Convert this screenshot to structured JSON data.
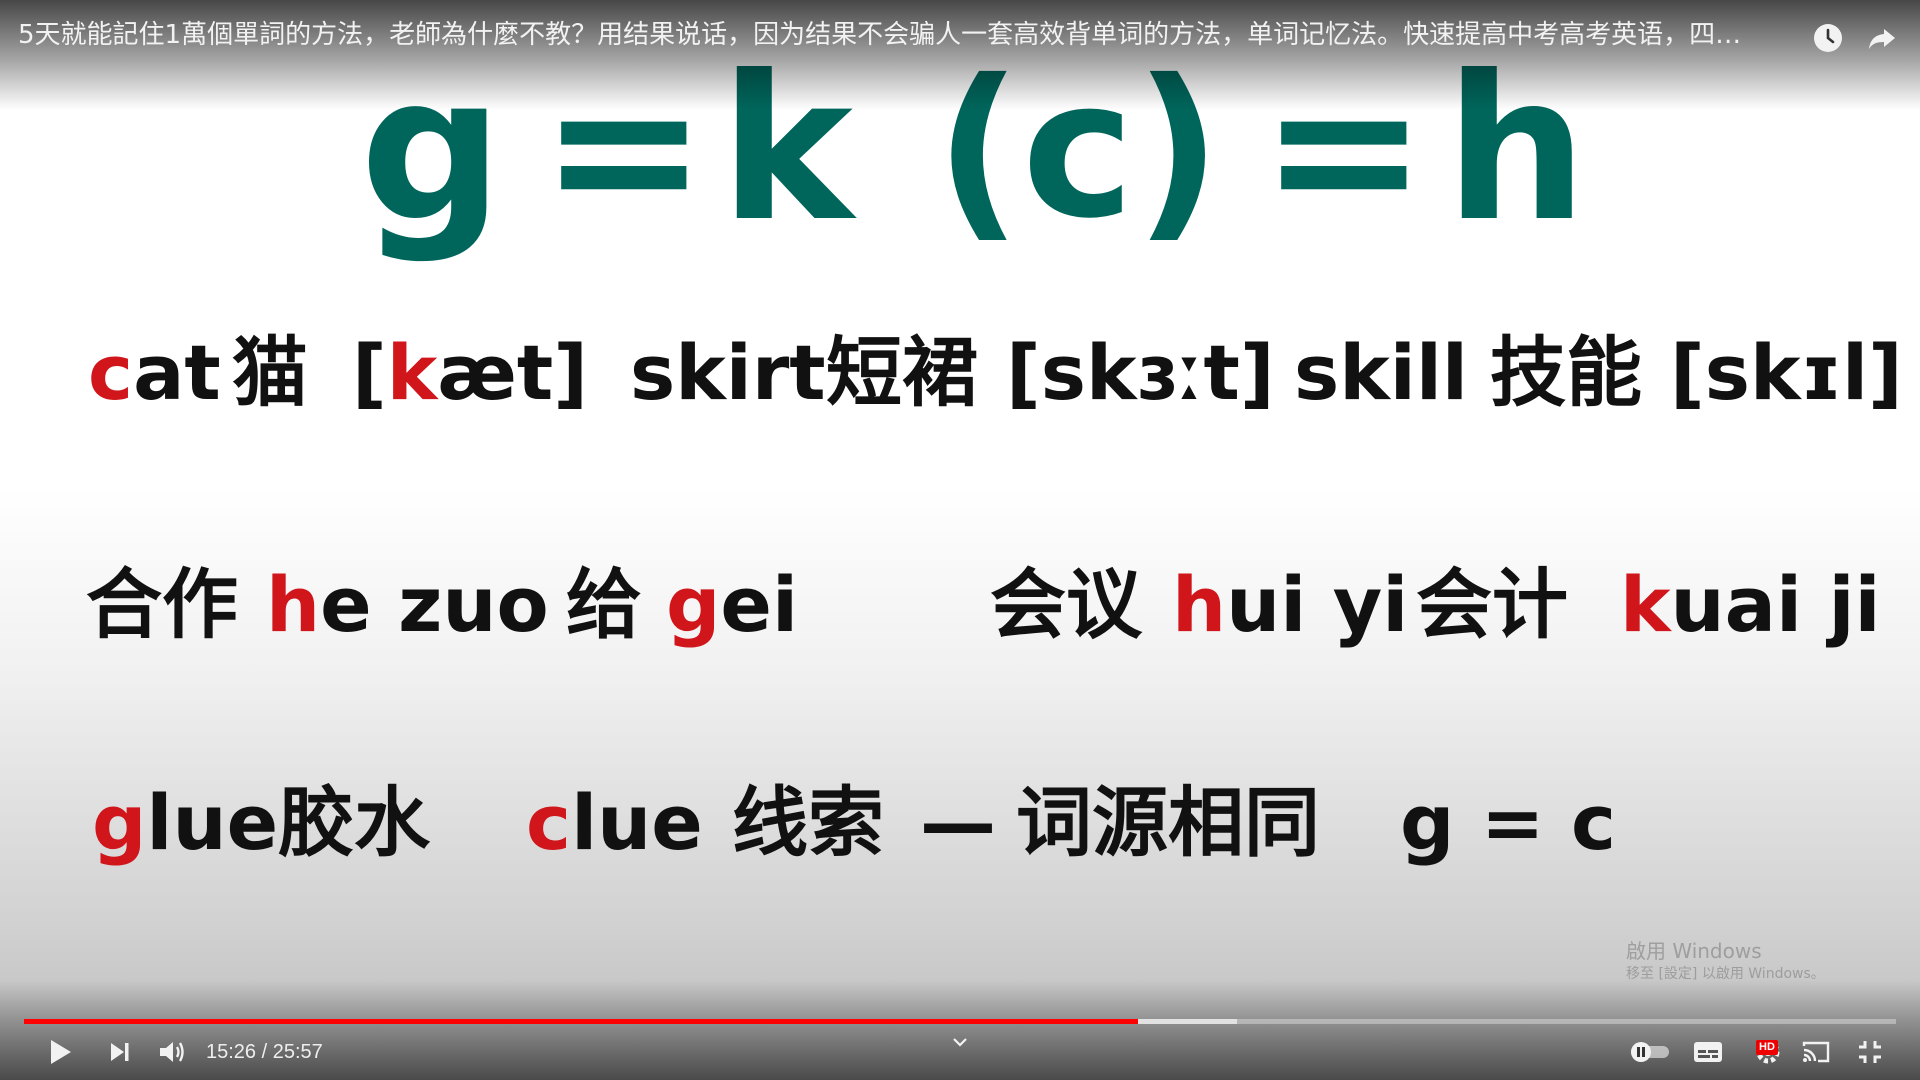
{
  "video": {
    "title": "5天就能記住1萬個單詞的方法，老師為什麼不教？用结果说话，因为结果不会骗人一套高效背单词的方法，单词记忆法。快速提高中考高考英语，四…"
  },
  "slide": {
    "formula": {
      "g": "g",
      "eq1": "=",
      "k": "k",
      "c": "(c)",
      "eq2": "=",
      "h": "h"
    },
    "row1": {
      "cat_red": "c",
      "cat_rest": "at",
      "cat_cn": "猫",
      "cat_ipa_open": "[",
      "cat_ipa_red": "k",
      "cat_ipa_rest": "æt]",
      "skirt": "skirt",
      "skirt_cn": "短裙",
      "skirt_ipa": "[skɜːt]",
      "skill": "skill",
      "skill_cn": "技能",
      "skill_ipa": "[skɪl]"
    },
    "row2": {
      "hezuo_cn": "合作",
      "hezuo_red": "h",
      "hezuo_rest": "e zuo",
      "gei_cn": "给",
      "gei_red": "g",
      "gei_rest": "ei",
      "huiyi_cn": "会议",
      "huiyi_red": "h",
      "huiyi_rest": "ui yi",
      "kuaiji_cn": "会计",
      "kuaiji_red": "k",
      "kuaiji_rest": "uai ji"
    },
    "row3": {
      "glue_red": "g",
      "glue_rest": "lue",
      "glue_cn": "胶水",
      "clue_red": "c",
      "clue_rest": "lue",
      "clue_cn": "线索",
      "dash": "—",
      "same_root": "词源相同",
      "g_eq_c": "g = c"
    }
  },
  "watermark": {
    "line1": "啟用 Windows",
    "line2": "移至 [設定] 以啟用 Windows。"
  },
  "player": {
    "current_time": "15:26",
    "duration": "25:57",
    "time_text": "15:26 / 25:57",
    "progress_fraction": 0.595,
    "buffered_fraction": 0.648,
    "hd_label": "HD",
    "accent_color": "#ff0000",
    "icons": [
      "play-icon",
      "next-icon",
      "volume-icon",
      "chevron-down-icon",
      "autoplay-toggle-icon",
      "subtitles-icon",
      "settings-icon",
      "cast-icon",
      "exit-fullscreen-icon",
      "clock-icon",
      "share-icon"
    ]
  }
}
